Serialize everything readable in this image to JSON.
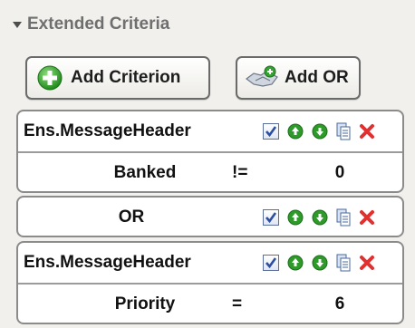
{
  "section": {
    "title": "Extended Criteria"
  },
  "buttons": {
    "add_criterion": "Add Criterion",
    "add_or": "Add OR"
  },
  "criteria": [
    {
      "title": "Ens.MessageHeader",
      "checked": true,
      "condition": {
        "field": "Banked",
        "operator": "!=",
        "value": "0"
      }
    },
    {
      "title": "OR",
      "checked": true
    },
    {
      "title": "Ens.MessageHeader",
      "checked": true,
      "condition": {
        "field": "Priority",
        "operator": "=",
        "value": "6"
      }
    }
  ],
  "colors": {
    "accent_green": "#2e9a2a",
    "delete_red": "#e03030",
    "checkbox_blue": "#2b4f9e"
  },
  "icons": [
    "collapse-triangle-icon",
    "add-green-plus-icon",
    "add-or-handshake-icon",
    "checkbox-icon",
    "move-up-icon",
    "move-down-icon",
    "copy-document-icon",
    "delete-x-icon"
  ]
}
